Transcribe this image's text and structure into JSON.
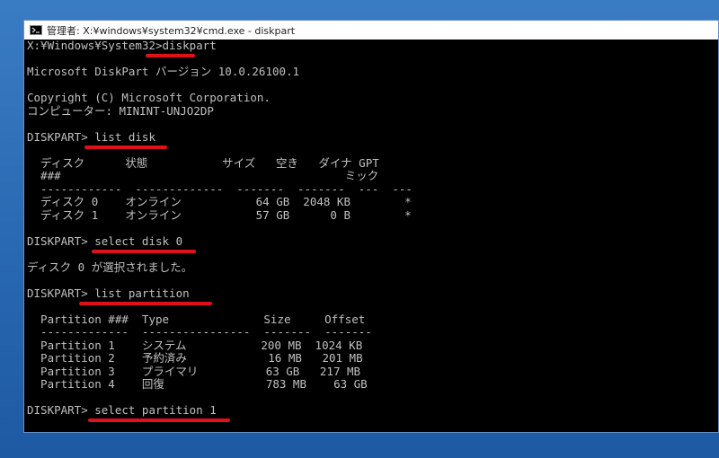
{
  "window": {
    "title": "管理者: X:¥windows¥system32¥cmd.exe - diskpart"
  },
  "console": {
    "lines": [
      "X:¥Windows¥System32>diskpart",
      "",
      "Microsoft DiskPart バージョン 10.0.26100.1",
      "",
      "Copyright (C) Microsoft Corporation.",
      "コンピューター: MININT-UNJO2DP",
      "",
      "DISKPART> list disk",
      "",
      "  ディスク      状態           サイズ   空き   ダイナ GPT",
      "  ###                                          ミック",
      "  ------------  -------------  -------  -------  ---  ---",
      "  ディスク 0    オンライン           64 GB  2048 KB        *",
      "  ディスク 1    オンライン           57 GB      0 B        *",
      "",
      "DISKPART> select disk 0",
      "",
      "ディスク 0 が選択されました。",
      "",
      "DISKPART> list partition",
      "",
      "  Partition ###  Type              Size     Offset",
      "  -------------  ----------------  -------  -------",
      "  Partition 1    システム           200 MB  1024 KB",
      "  Partition 2    予約済み            16 MB   201 MB",
      "  Partition 3    プライマリ          63 GB   217 MB",
      "  Partition 4    回復               783 MB    63 GB",
      "",
      "DISKPART> select partition 1"
    ]
  }
}
